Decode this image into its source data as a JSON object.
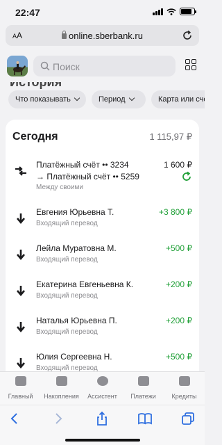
{
  "status": {
    "time": "22:47",
    "battery_level": 0.85
  },
  "browser": {
    "aa_small": "A",
    "aa_big": "A",
    "url": "online.sberbank.ru"
  },
  "header": {
    "search_placeholder": "Поиск",
    "section_title_cut": "История"
  },
  "filters": [
    "Что показывать",
    "Период",
    "Карта или счё"
  ],
  "day": {
    "title": "Сегодня",
    "total": "1 115,97 ₽"
  },
  "transactions": [
    {
      "icon": "transfer-between-accounts-icon",
      "line1": "Платёжный счёт •• 3234",
      "line2": "→ Платёжный счёт •• 5259",
      "sub": "Между своими",
      "amount": "1 600 ₽",
      "status_icon": "refresh-icon"
    },
    {
      "icon": "incoming-arrow-icon",
      "name": "Евгения Юрьевна Т.",
      "sub": "Входящий перевод",
      "amount": "+3 800 ₽"
    },
    {
      "icon": "incoming-arrow-icon",
      "name": "Лейла Муратовна М.",
      "sub": "Входящий перевод",
      "amount": "+500 ₽"
    },
    {
      "icon": "incoming-arrow-icon",
      "name": "Екатерина Евгеньевна К.",
      "sub": "Входящий перевод",
      "amount": "+200 ₽"
    },
    {
      "icon": "incoming-arrow-icon",
      "name": "Наталья Юрьевна П.",
      "sub": "Входящий перевод",
      "amount": "+200 ₽"
    },
    {
      "icon": "incoming-arrow-icon",
      "name": "Юлия Сергеевна Н.",
      "sub": "Входящий перевод",
      "amount": "+500 ₽"
    }
  ],
  "tabbar": [
    "Главный",
    "Накопления",
    "Ассистент",
    "Платежи",
    "Кредиты"
  ],
  "colors": {
    "positive": "#21a038",
    "background": "#f2f2f4",
    "card": "#ffffff"
  }
}
